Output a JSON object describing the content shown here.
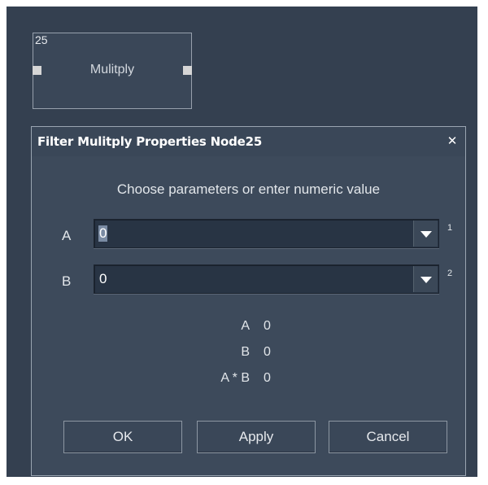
{
  "node": {
    "id": "25",
    "title": "Mulitply"
  },
  "dialog": {
    "title": "Filter Mulitply Properties Node25",
    "close_glyph": "✕",
    "subtitle": "Choose parameters or enter numeric value",
    "params": [
      {
        "label": "A",
        "value": "0",
        "index": "1"
      },
      {
        "label": "B",
        "value": "0",
        "index": "2"
      }
    ],
    "results": [
      {
        "label": "A",
        "value": "0"
      },
      {
        "label": "B",
        "value": "0"
      },
      {
        "label": "A * B",
        "value": "0"
      }
    ],
    "buttons": {
      "ok": "OK",
      "apply": "Apply",
      "cancel": "Cancel"
    }
  },
  "colors": {
    "canvas": "#344050",
    "dialog": "#3d4a5b",
    "input": "#283444",
    "text": "#e2e6ea"
  }
}
